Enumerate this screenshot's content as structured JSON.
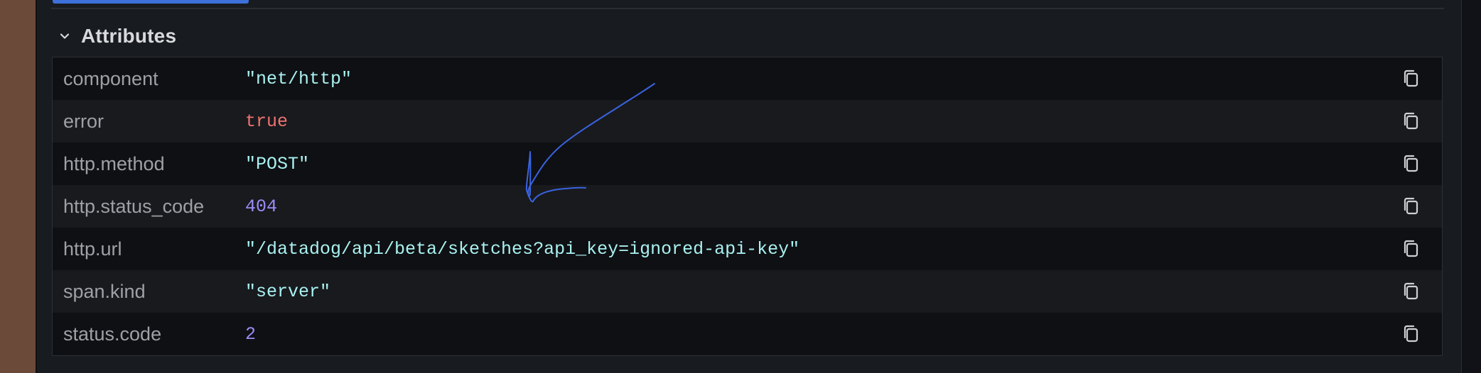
{
  "section": {
    "title": "Attributes",
    "expanded": true
  },
  "attributes": [
    {
      "key": "component",
      "value": "\"net/http\"",
      "type": "string"
    },
    {
      "key": "error",
      "value": "true",
      "type": "boolean"
    },
    {
      "key": "http.method",
      "value": "\"POST\"",
      "type": "string"
    },
    {
      "key": "http.status_code",
      "value": "404",
      "type": "number"
    },
    {
      "key": "http.url",
      "value": "\"/datadog/api/beta/sketches?api_key=ignored-api-key\"",
      "type": "string"
    },
    {
      "key": "span.kind",
      "value": "\"server\"",
      "type": "string"
    },
    {
      "key": "status.code",
      "value": "2",
      "type": "number"
    }
  ],
  "icons": {
    "section_toggle": "chevron-down-icon",
    "row_action": "copy-icon"
  },
  "colors": {
    "string_value": "#a9f1f1",
    "boolean_value": "#ef7370",
    "number_value": "#9c8cf5",
    "key_text": "#9fa0a6",
    "active_tab": "#3d71d9",
    "annotation_stroke": "#3a63e0"
  }
}
